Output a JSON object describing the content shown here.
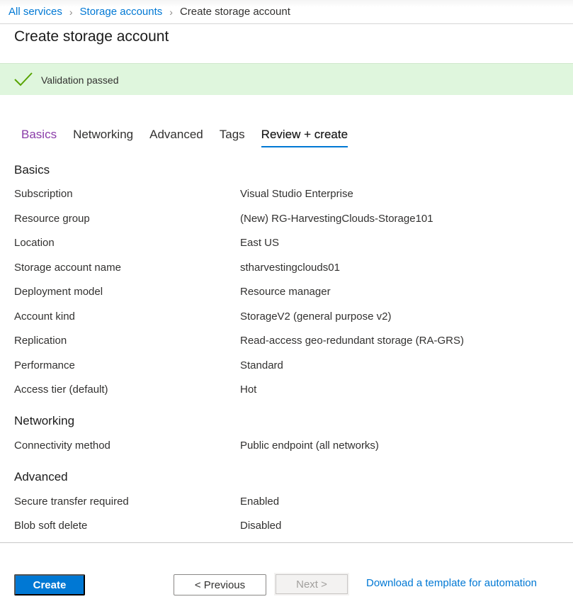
{
  "breadcrumb": {
    "items": [
      {
        "label": "All services",
        "link": true
      },
      {
        "label": "Storage accounts",
        "link": true
      },
      {
        "label": "Create storage account",
        "link": false
      }
    ],
    "separator": "›"
  },
  "page_title": "Create storage account",
  "banner": {
    "icon": "checkmark-icon",
    "text": "Validation passed",
    "color": "#dff6dd",
    "icon_color": "#57a300"
  },
  "tabs": [
    {
      "label": "Basics",
      "state": "visited"
    },
    {
      "label": "Networking",
      "state": "default"
    },
    {
      "label": "Advanced",
      "state": "default"
    },
    {
      "label": "Tags",
      "state": "default"
    },
    {
      "label": "Review + create",
      "state": "active"
    }
  ],
  "summary": {
    "basics": {
      "title": "Basics",
      "rows": [
        {
          "label": "Subscription",
          "value": "Visual Studio Enterprise"
        },
        {
          "label": "Resource group",
          "value": "(New) RG-HarvestingClouds-Storage101"
        },
        {
          "label": "Location",
          "value": "East US"
        },
        {
          "label": "Storage account name",
          "value": "stharvestingclouds01"
        },
        {
          "label": "Deployment model",
          "value": "Resource manager"
        },
        {
          "label": "Account kind",
          "value": "StorageV2 (general purpose v2)"
        },
        {
          "label": "Replication",
          "value": "Read-access geo-redundant storage (RA-GRS)"
        },
        {
          "label": "Performance",
          "value": "Standard"
        },
        {
          "label": "Access tier (default)",
          "value": "Hot"
        }
      ]
    },
    "networking": {
      "title": "Networking",
      "rows": [
        {
          "label": "Connectivity method",
          "value": "Public endpoint (all networks)"
        }
      ]
    },
    "advanced": {
      "title": "Advanced",
      "rows": [
        {
          "label": "Secure transfer required",
          "value": "Enabled"
        },
        {
          "label": "Blob soft delete",
          "value": "Disabled"
        }
      ]
    }
  },
  "footer": {
    "create_label": "Create",
    "previous_label": "< Previous",
    "next_label": "Next >",
    "next_disabled": true,
    "download_link": "Download a template for automation"
  },
  "colors": {
    "accent": "#0078d4",
    "visited_tab": "#8a3ca8"
  }
}
